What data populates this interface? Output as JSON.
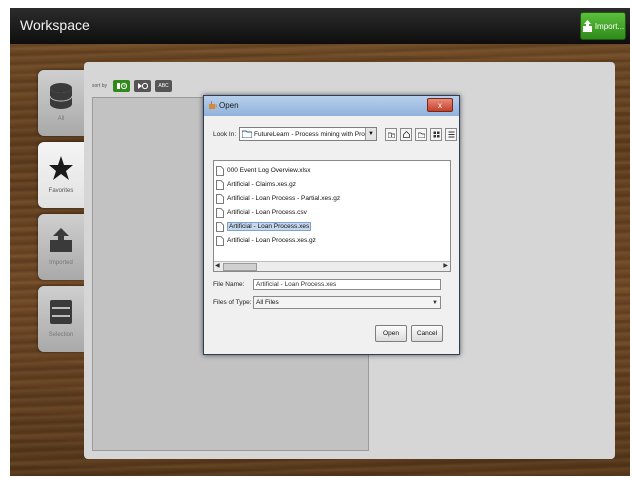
{
  "app": {
    "title": "Workspace"
  },
  "header": {
    "import_label": "Import..."
  },
  "sidebar": {
    "items": [
      {
        "label": "All",
        "icon": "database-icon",
        "active": false
      },
      {
        "label": "Favorites",
        "icon": "star-icon",
        "active": true
      },
      {
        "label": "Imported",
        "icon": "import-icon",
        "active": false
      },
      {
        "label": "Selection",
        "icon": "selection-icon",
        "active": false
      }
    ]
  },
  "sortbar": {
    "label": "sort by",
    "buttons": [
      {
        "name": "sort-date",
        "icon": "clock-icon",
        "active": true
      },
      {
        "name": "sort-play",
        "icon": "play-icon",
        "active": false
      },
      {
        "name": "sort-abc",
        "label": "ABC",
        "active": false
      }
    ]
  },
  "dialog": {
    "title": "Open",
    "close_label": "x",
    "look_in_label": "Look In:",
    "look_in_value": "FutureLearn - Process mining with Pro...",
    "files": [
      {
        "name": "000 Event Log Overview.xlsx",
        "selected": false
      },
      {
        "name": "Artificial - Claims.xes.gz",
        "selected": false
      },
      {
        "name": "Artificial - Loan Process - Partial.xes.gz",
        "selected": false
      },
      {
        "name": "Artificial - Loan Process.csv",
        "selected": false
      },
      {
        "name": "Artificial - Loan Process.xes",
        "selected": true
      },
      {
        "name": "Artificial - Loan Process.xes.gz",
        "selected": false
      }
    ],
    "file_name_label": "File Name:",
    "file_name_value": "Artificial - Loan Process.xes",
    "files_of_type_label": "Files of Type:",
    "files_of_type_value": "All Files",
    "open_label": "Open",
    "cancel_label": "Cancel"
  },
  "colors": {
    "accent_green": "#2f8a1a",
    "title_bar_blue": "#90b2db",
    "selection_blue": "#c6d8ee",
    "close_red": "#c4412b"
  }
}
